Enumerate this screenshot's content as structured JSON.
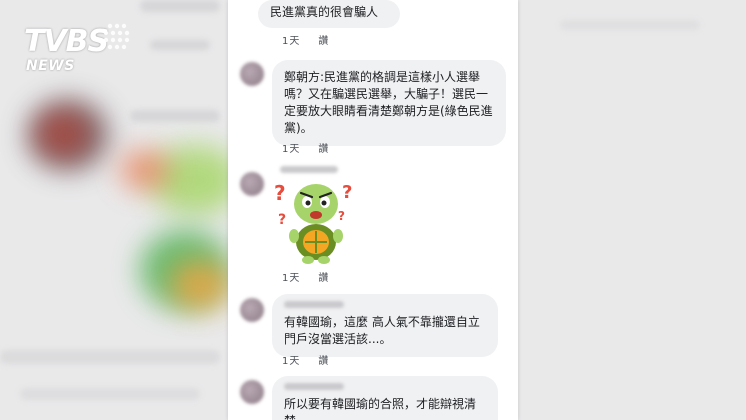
{
  "broadcaster": {
    "logo_text": "TVBS",
    "sub_text": "NEWS"
  },
  "comments": [
    {
      "text": "民進黨真的很會騙人",
      "time": "1天",
      "reply": "讚"
    },
    {
      "text": "鄭朝方:民進黨的格調是這樣小人選舉嗎？又在騙選民選舉，大騙子！選民一定要放大眼睛看清楚鄭朝方是(綠色民進黨)。",
      "time": "1天",
      "reply": "讚"
    },
    {
      "sticker": "angry-turtle-sticker",
      "time": "1天",
      "reply": "讚"
    },
    {
      "text": "有韓國瑜，這麼 高人氣不靠攏還自立門戶沒當選活該...。",
      "time": "1天",
      "reply": "讚"
    },
    {
      "text": "所以要有韓國瑜的合照，才能辯視清楚。"
    }
  ],
  "colors": {
    "bubble": "#f0f1f3",
    "text": "#1c1e21",
    "meta": "#4b4f56",
    "logo": "#ffffff"
  }
}
